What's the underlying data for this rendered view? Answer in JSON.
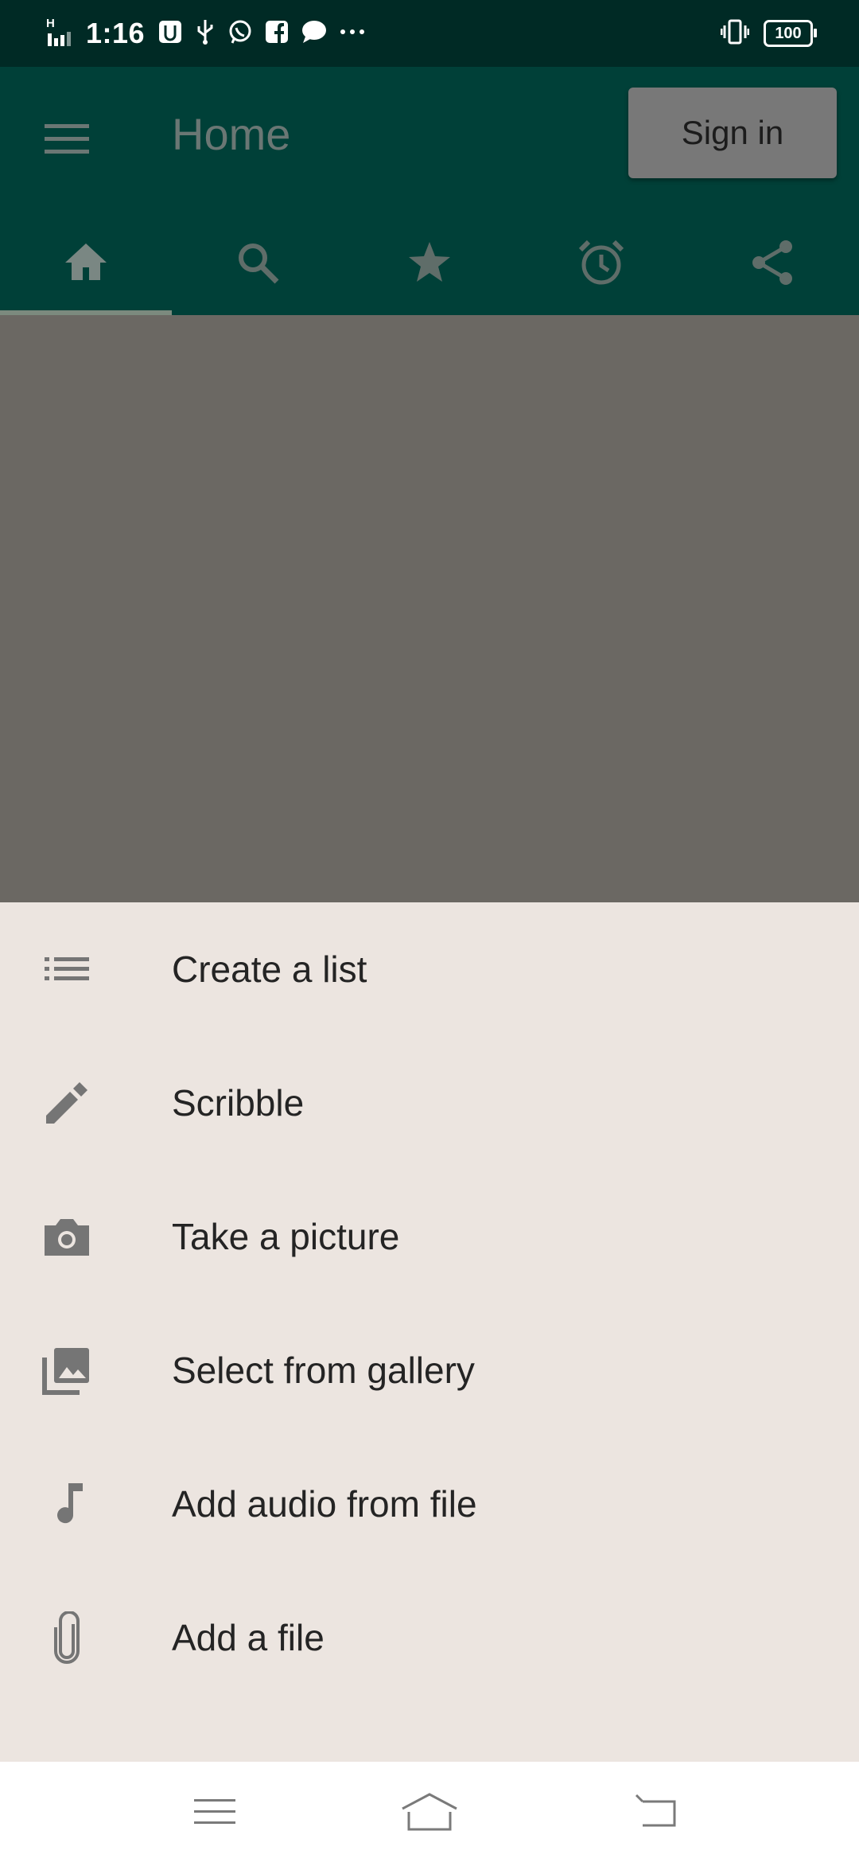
{
  "status_bar": {
    "time": "1:16",
    "signal_label": "H",
    "battery": "100",
    "icons": [
      "signal-icon",
      "usb-debug-icon",
      "usb-icon",
      "whatsapp-icon",
      "facebook-icon",
      "chat-icon",
      "more-icon",
      "vibrate-icon",
      "battery-icon"
    ]
  },
  "app_bar": {
    "title": "Home",
    "signin_label": "Sign in",
    "background": "#004038"
  },
  "tabs": [
    {
      "icon": "home-icon",
      "selected": true
    },
    {
      "icon": "search-icon",
      "selected": false
    },
    {
      "icon": "star-icon",
      "selected": false
    },
    {
      "icon": "alarm-icon",
      "selected": false
    },
    {
      "icon": "share-icon",
      "selected": false
    }
  ],
  "sheet": {
    "items": [
      {
        "label": "Create a list",
        "icon": "list-icon"
      },
      {
        "label": "Scribble",
        "icon": "pencil-icon"
      },
      {
        "label": "Take a picture",
        "icon": "camera-icon"
      },
      {
        "label": "Select from gallery",
        "icon": "gallery-icon"
      },
      {
        "label": "Add audio from file",
        "icon": "music-note-icon"
      },
      {
        "label": "Add a file",
        "icon": "attachment-icon"
      }
    ]
  },
  "colors": {
    "status_bar": "#002a25",
    "scrim": "#6b6863",
    "sheet": "#ece5e0",
    "icon_gray": "#757575"
  }
}
